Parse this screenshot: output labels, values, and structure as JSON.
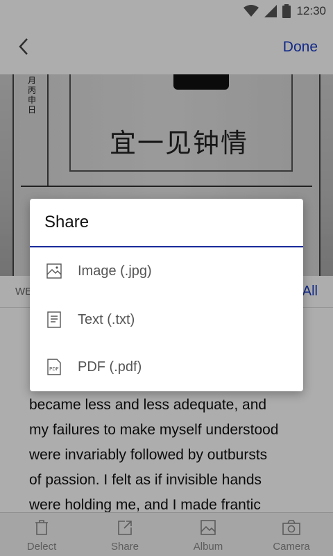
{
  "status_bar": {
    "time": "12:30",
    "icons": [
      "wifi-icon",
      "signal-icon",
      "battery-icon"
    ]
  },
  "header": {
    "back_icon": "chevron-left-icon",
    "done_label": "Done"
  },
  "photo": {
    "vertical_text": "月丙申日",
    "chinese_title": "宜一见钟情"
  },
  "tabs": {
    "left_label": "WE",
    "right_label": "All"
  },
  "body_text": {
    "lines": [
      "became less and less adequate, and",
      "my failures to make myself understood",
      "were invariably followed by outbursts",
      "of passion. I felt as if invisible hands",
      "were holding me, and I made frantic"
    ]
  },
  "share_dialog": {
    "title": "Share",
    "options": [
      {
        "label": "Image (.jpg)",
        "icon": "image-icon"
      },
      {
        "label": "Text (.txt)",
        "icon": "text-file-icon"
      },
      {
        "label": "PDF (.pdf)",
        "icon": "pdf-icon"
      }
    ],
    "accent": "#1a2a9a"
  },
  "bottom_bar": {
    "buttons": [
      {
        "label": "Delect",
        "icon": "trash-icon"
      },
      {
        "label": "Share",
        "icon": "share-icon"
      },
      {
        "label": "Album",
        "icon": "album-icon"
      },
      {
        "label": "Camera",
        "icon": "camera-icon"
      }
    ]
  },
  "colors": {
    "accent": "#1a3cc8",
    "scrim": "rgba(0,0,0,0.32)"
  }
}
